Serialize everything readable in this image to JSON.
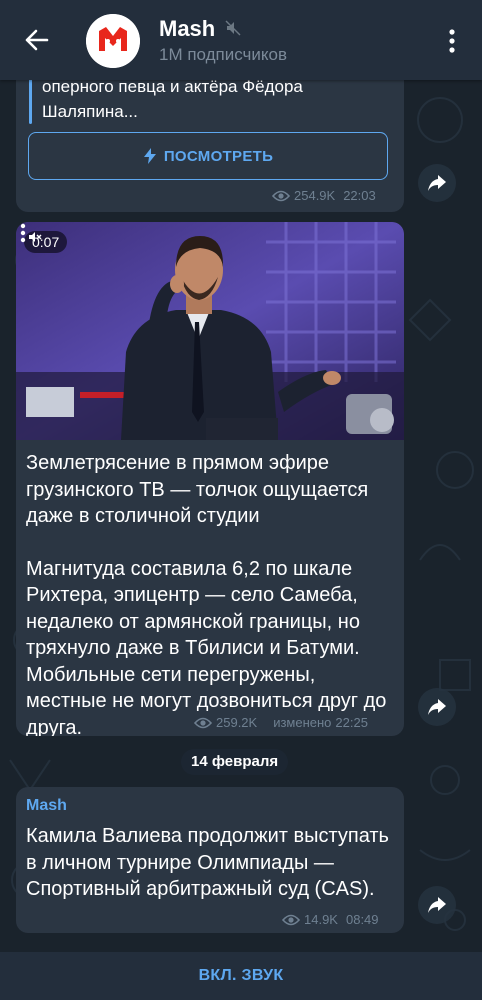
{
  "header": {
    "channel_name": "Mash",
    "subscribers": "1M подписчиков"
  },
  "messages": [
    {
      "quote_lines": [
        "оперного певца и актёра Фёдора",
        "Шаляпина..."
      ],
      "button_label": "ПОСМОТРЕТЬ",
      "views": "254.9K",
      "time": "22:03"
    },
    {
      "video_duration": "0:07",
      "paragraphs": [
        "Землетрясение в прямом эфире грузинского ТВ — толчок ощущается даже в столичной студии",
        "Магнитуда составила 6,2 по шкале Рихтера, эпицентр — село Самеба, недалеко от армянской границы, но тряхнуло даже в Тбилиси и Батуми. Мобильные сети перегружены, местные не могут дозвониться друг до друга."
      ],
      "views": "259.2K",
      "edited_label": "изменено",
      "time": "22:25"
    },
    {
      "sender": "Mash",
      "text": "Камила Валиева продолжит выступать в личном турнире Олимпиады — Спортивный арбитражный суд (CAS).",
      "views": "14.9K",
      "time": "08:49"
    }
  ],
  "date_separator": "14 февраля",
  "bottom_bar": {
    "action_label": "ВКЛ. ЗВУК"
  },
  "colors": {
    "accent": "#5ea8f0",
    "header_bg": "#232e3c",
    "bubble_bg": "#2b3643",
    "chat_bg": "#1a232c",
    "meta_text": "#6f8091"
  },
  "icons": [
    "back-arrow-icon",
    "mash-logo-icon",
    "mute-icon",
    "more-vertical-icon",
    "bolt-icon",
    "eye-icon",
    "share-icon",
    "volume-off-icon"
  ]
}
